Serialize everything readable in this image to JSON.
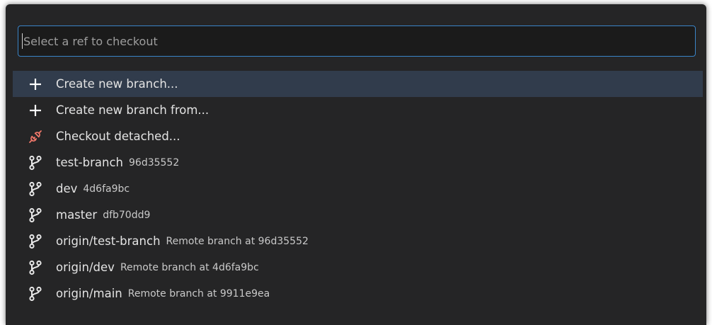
{
  "search": {
    "placeholder": "Select a ref to checkout",
    "value": ""
  },
  "colors": {
    "panel_bg": "#252526",
    "input_border": "#3a84c8",
    "selected_bg": "#313c4c",
    "text": "#e3e3e3",
    "detach_icon": "#f0776a"
  },
  "items": [
    {
      "icon": "add-icon",
      "label": "Create new branch...",
      "description": "",
      "selected": true
    },
    {
      "icon": "add-icon",
      "label": "Create new branch from...",
      "description": "",
      "selected": false
    },
    {
      "icon": "debug-disconnect-icon",
      "label": "Checkout detached...",
      "description": "",
      "selected": false
    },
    {
      "icon": "git-branch-icon",
      "label": "test-branch",
      "description": "96d35552",
      "selected": false
    },
    {
      "icon": "git-branch-icon",
      "label": "dev",
      "description": "4d6fa9bc",
      "selected": false
    },
    {
      "icon": "git-branch-icon",
      "label": "master",
      "description": "dfb70dd9",
      "selected": false
    },
    {
      "icon": "git-branch-icon",
      "label": "origin/test-branch",
      "description": "Remote branch at 96d35552",
      "selected": false
    },
    {
      "icon": "git-branch-icon",
      "label": "origin/dev",
      "description": "Remote branch at 4d6fa9bc",
      "selected": false
    },
    {
      "icon": "git-branch-icon",
      "label": "origin/main",
      "description": "Remote branch at 9911e9ea",
      "selected": false
    }
  ]
}
